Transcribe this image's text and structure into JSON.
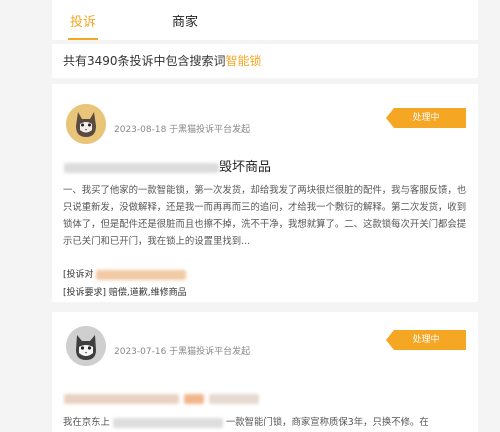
{
  "tabs": {
    "complaints": "投诉",
    "merchants": "商家"
  },
  "summary": {
    "prefix": "共有3490条投诉中包含搜索词",
    "keyword": "智能锁"
  },
  "cards": [
    {
      "date_source": "2023-08-18 于黑猫投诉平台发起",
      "status": "处理中",
      "title_visible": "毁坏商品",
      "body": "一、我买了他家的一款智能锁，第一次发货，却给我发了两块很烂很脏的配件，我与客服反馈，也只说重新发，没做解释，还是我一而再再而三的追问，才给我一个敷衍的解释。第二次发货，收到锁体了，但是配件还是很脏而且也擦不掉，洗不干净，我想就算了。二、这款锁每次开关门都会提示已关门和已开门，我在锁上的设置里找到...",
      "field1_label": "[投诉对",
      "field2_label": "[投诉要求]",
      "field2_value": "赔偿,道歉,维修商品"
    },
    {
      "date_source": "2023-07-16 于黑猫投诉平台发起",
      "status": "处理中",
      "body_prefix": "我在京东上",
      "body_suffix": "一款智能门锁，商家宣称质保3年，只换不修。在"
    }
  ]
}
